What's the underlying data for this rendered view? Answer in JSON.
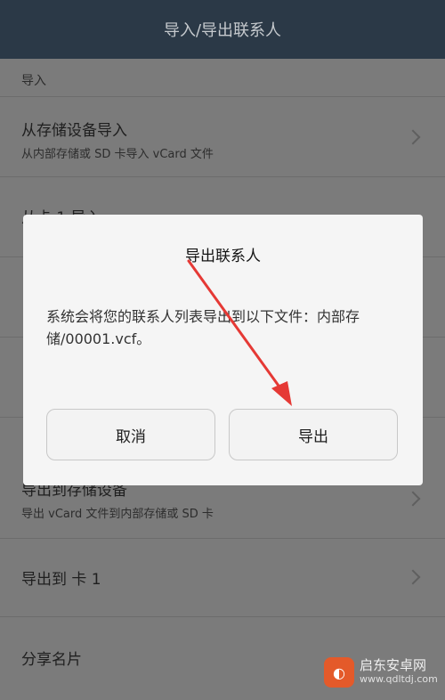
{
  "header": {
    "title": "导入/导出联系人"
  },
  "list": {
    "section_import": "导入",
    "items": [
      {
        "title": "从存储设备导入",
        "subtitle": "从内部存储或 SD 卡导入 vCard 文件"
      },
      {
        "title": "从卡 1 导入"
      },
      {
        "title": "导出到存储设备",
        "subtitle": "导出 vCard 文件到内部存储或 SD 卡"
      },
      {
        "title": "导出到 卡 1"
      },
      {
        "title": "分享名片"
      }
    ]
  },
  "dialog": {
    "title": "导出联系人",
    "message": "系统会将您的联系人列表导出到以下文件：内部存储/00001.vcf。",
    "cancel_label": "取消",
    "export_label": "导出"
  },
  "watermark": {
    "name": "启东安卓网",
    "url": "www.qdltdj.com"
  },
  "colors": {
    "header_bg": "#2b3947",
    "annotation_arrow": "#e53935",
    "dim_overlay": "#7b7b7b"
  }
}
